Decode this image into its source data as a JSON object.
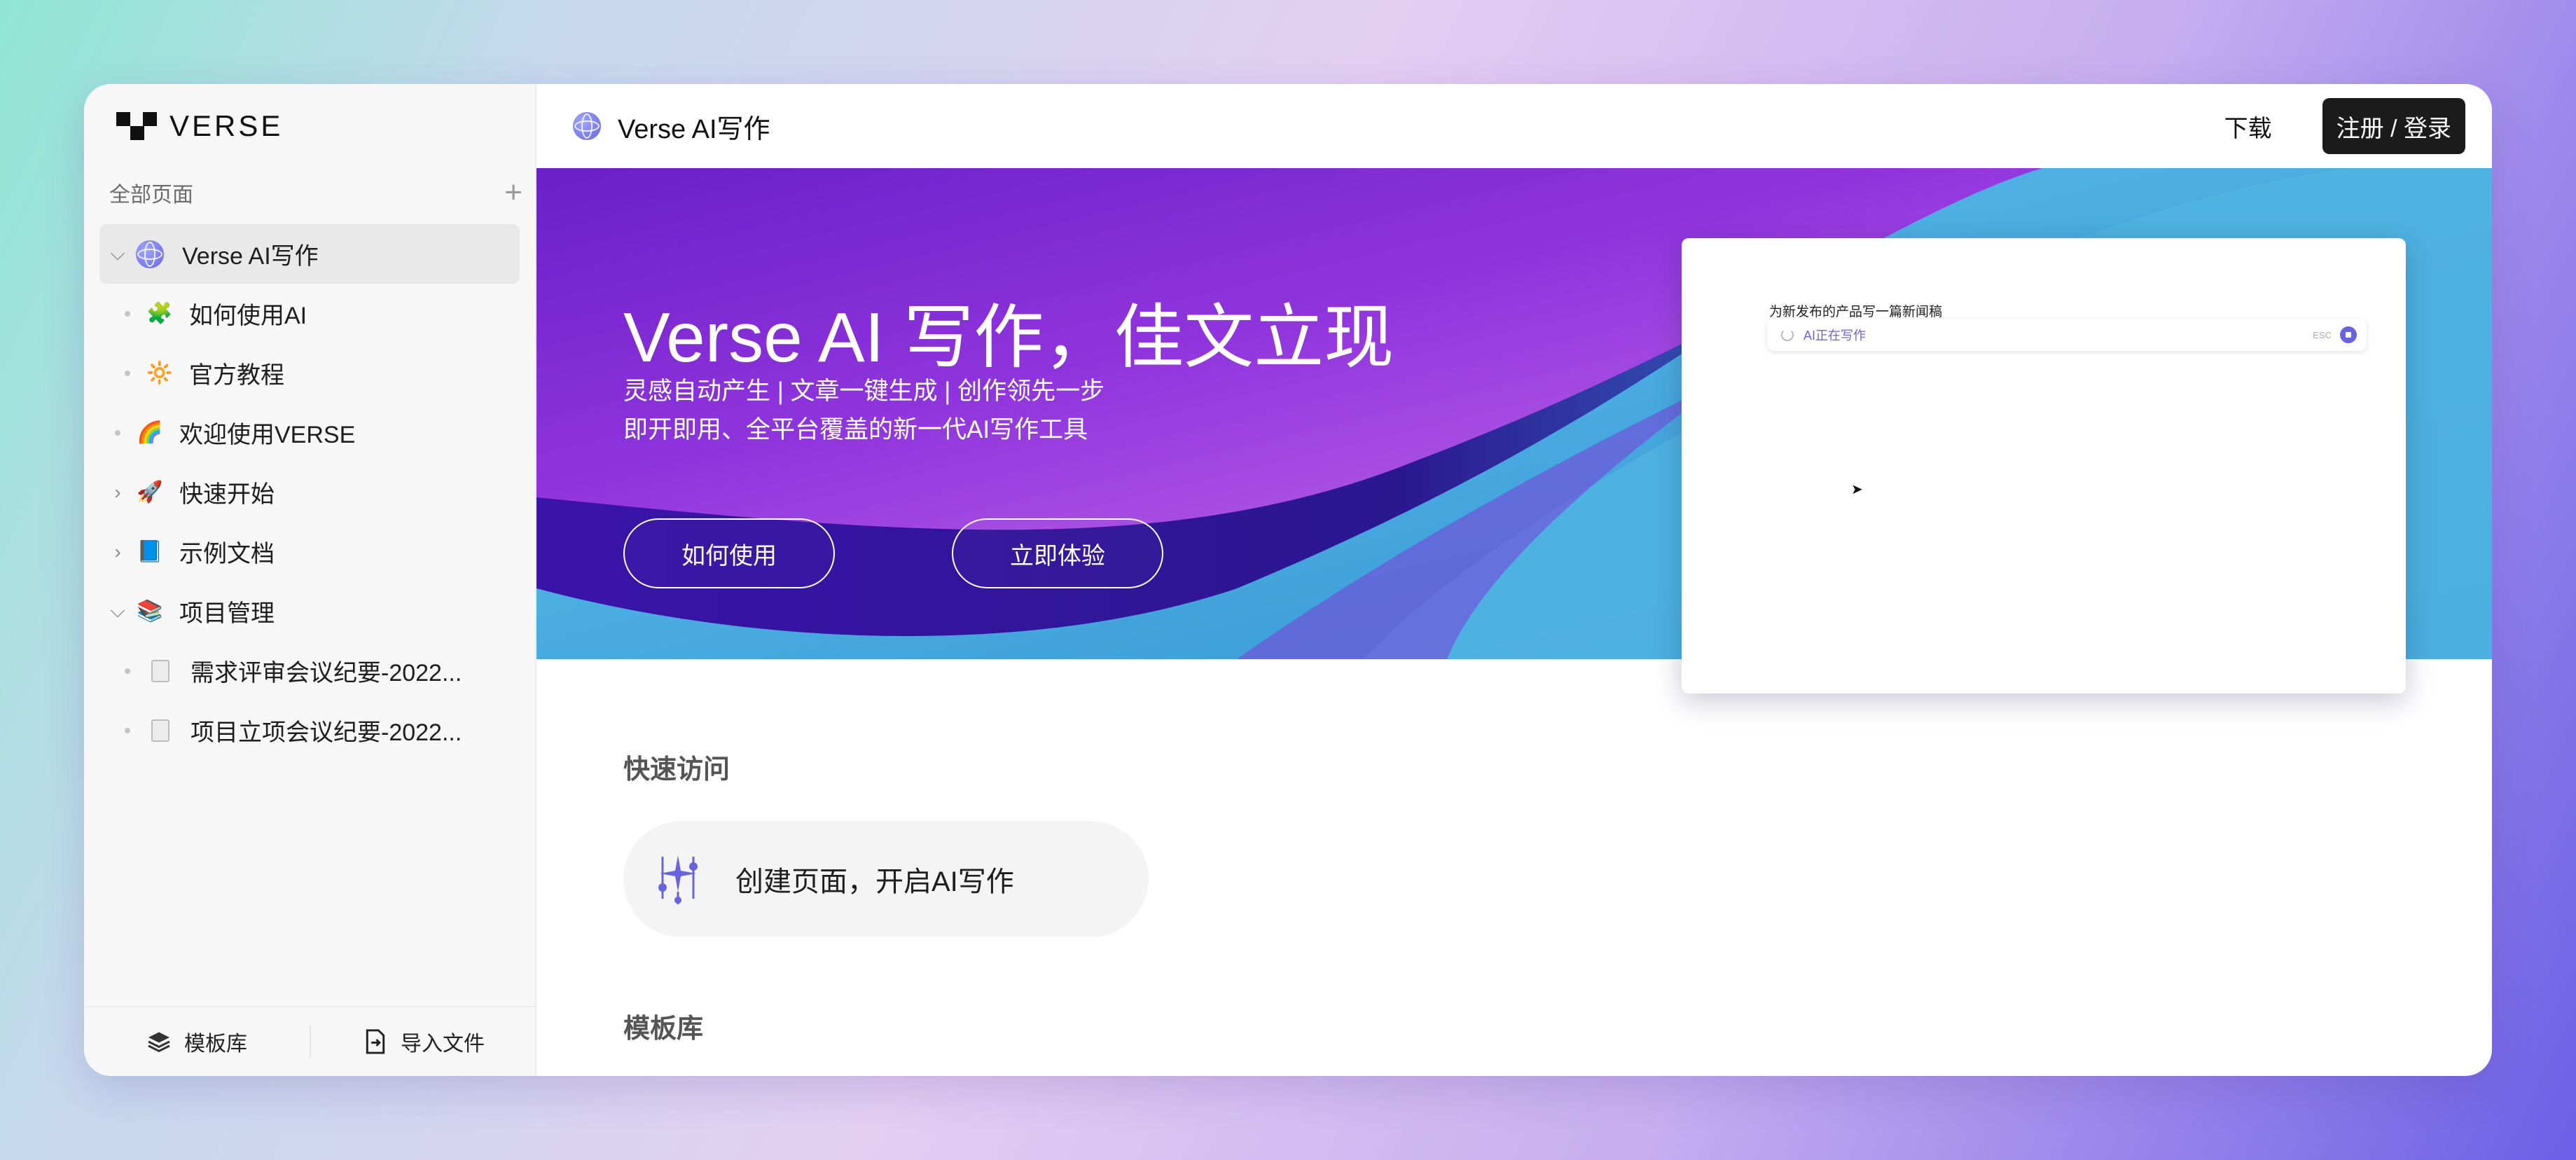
{
  "sidebar": {
    "brand": "VERSE",
    "section_label": "全部页面",
    "add_icon": "plus-icon",
    "tree": [
      {
        "label": "Verse AI写作",
        "icon": "globe-icon",
        "expanded": true,
        "active": true
      },
      {
        "label": "如何使用AI",
        "icon": "🧩",
        "level": 1
      },
      {
        "label": "官方教程",
        "icon": "🔆",
        "level": 1
      },
      {
        "label": "欢迎使用VERSE",
        "icon": "🌈"
      },
      {
        "label": "快速开始",
        "icon": "🚀",
        "expanded": false
      },
      {
        "label": "示例文档",
        "icon": "📘",
        "expanded": false
      },
      {
        "label": "项目管理",
        "icon": "📚",
        "expanded": true
      },
      {
        "label": "需求评审会议纪要-2022...",
        "icon": "document-icon",
        "level": 1
      },
      {
        "label": "项目立项会议纪要-2022...",
        "icon": "document-icon",
        "level": 1
      }
    ],
    "footer": {
      "templates_label": "模板库",
      "import_label": "导入文件"
    }
  },
  "topbar": {
    "page_title": "Verse AI写作",
    "download_label": "下载",
    "login_label": "注册 / 登录"
  },
  "hero": {
    "title": "Verse AI 写作，佳文立现",
    "subtitle_1": "灵感自动产生 | 文章一键生成 | 创作领先一步",
    "subtitle_2": "即开即用、全平台覆盖的新一代AI写作工具",
    "how_to_label": "如何使用",
    "try_label": "立即体验",
    "preview": {
      "prompt": "为新发布的产品写一篇新闻稿",
      "status": "AI正在写作",
      "esc_label": "ESC"
    }
  },
  "main": {
    "quick_access_title": "快速访问",
    "quick_card_label": "创建页面，开启AI写作",
    "template_title": "模板库"
  },
  "colors": {
    "accent": "#6a63e0",
    "dark_button": "#1b1b1b",
    "hero_purple": "#7d2fd6",
    "hero_blue": "#3fa9d9"
  }
}
